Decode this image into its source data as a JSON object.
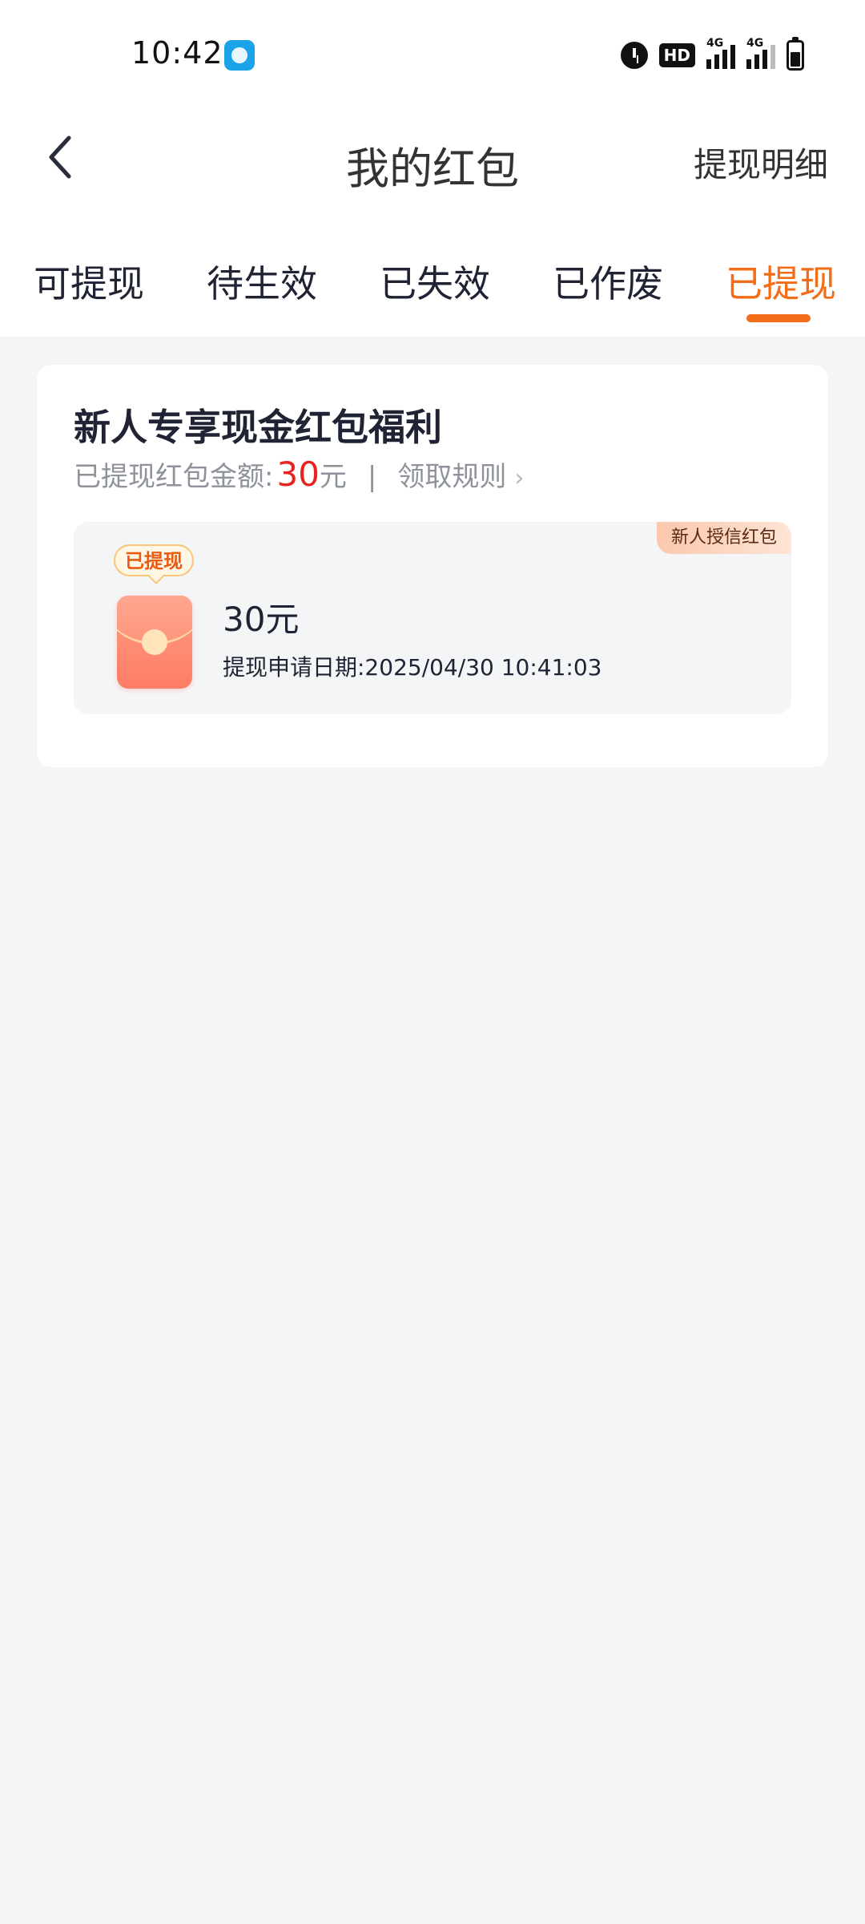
{
  "status_bar": {
    "time": "10:42",
    "network1": "4G",
    "network2": "4G",
    "hd": "HD"
  },
  "header": {
    "title": "我的红包",
    "right_link": "提现明细",
    "back_icon": "chevron-left-icon"
  },
  "tabs": [
    {
      "label": "可提现",
      "active": false
    },
    {
      "label": "待生效",
      "active": false
    },
    {
      "label": "已失效",
      "active": false
    },
    {
      "label": "已作废",
      "active": false
    },
    {
      "label": "已提现",
      "active": true
    }
  ],
  "card": {
    "title": "新人专享现金红包福利",
    "summary_label": "已提现红包金额:",
    "summary_amount": "30",
    "summary_unit": "元",
    "separator": "|",
    "rules_link": "领取规则",
    "item": {
      "corner_tag": "新人授信红包",
      "status_badge": "已提现",
      "amount": "30元",
      "date_text": "提现申请日期:2025/04/30 10:41:03"
    }
  },
  "colors": {
    "accent": "#f36c17",
    "amount_red": "#e8231f",
    "page_bg": "#f5f5f6"
  }
}
